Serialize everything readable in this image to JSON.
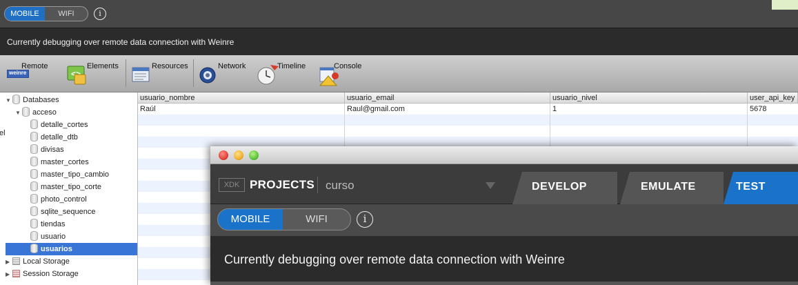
{
  "top": {
    "mode_toggle": {
      "mobile": "MOBILE",
      "wifi": "WIFI"
    },
    "info": "i"
  },
  "status": {
    "message": "Currently debugging over remote data connection with Weinre"
  },
  "toolbar": {
    "tools": [
      {
        "label": "Remote",
        "icon": "weinre-logo-icon",
        "badge": "weinre"
      },
      {
        "label": "Elements",
        "icon": "elements-icon"
      },
      {
        "label": "Resources",
        "icon": "resources-icon"
      },
      {
        "label": "Network",
        "icon": "network-icon"
      },
      {
        "label": "Timeline",
        "icon": "timeline-icon"
      },
      {
        "label": "Console",
        "icon": "console-icon"
      }
    ]
  },
  "tree": {
    "databases": "Databases",
    "acceso": "acceso",
    "tables": [
      "detalle_cortes",
      "detalle_dtb",
      "divisas",
      "master_cortes",
      "master_tipo_cambio",
      "master_tipo_corte",
      "photo_control",
      "sqlite_sequence",
      "tiendas",
      "usuario",
      "usuarios"
    ],
    "local_storage": "Local Storage",
    "session_storage": "Session Storage",
    "stray": "el"
  },
  "table": {
    "columns": [
      "usuario_nombre",
      "usuario_email",
      "usuario_nivel",
      "user_api_key"
    ],
    "rows": [
      [
        "Raúl",
        "Raul@gmail.com",
        "1",
        "5678"
      ]
    ]
  },
  "overlay": {
    "xdk": "XDK",
    "projects": "PROJECTS",
    "project_name": "curso",
    "tabs": [
      "DEVELOP",
      "EMULATE",
      "TEST"
    ],
    "mode_toggle": {
      "mobile": "MOBILE",
      "wifi": "WIFI"
    },
    "info": "i",
    "status": "Currently debugging over remote data connection with Weinre"
  },
  "colors": {
    "accent": "#1a73c9",
    "selection": "#3875d7",
    "dark": "#2b2b2b"
  }
}
